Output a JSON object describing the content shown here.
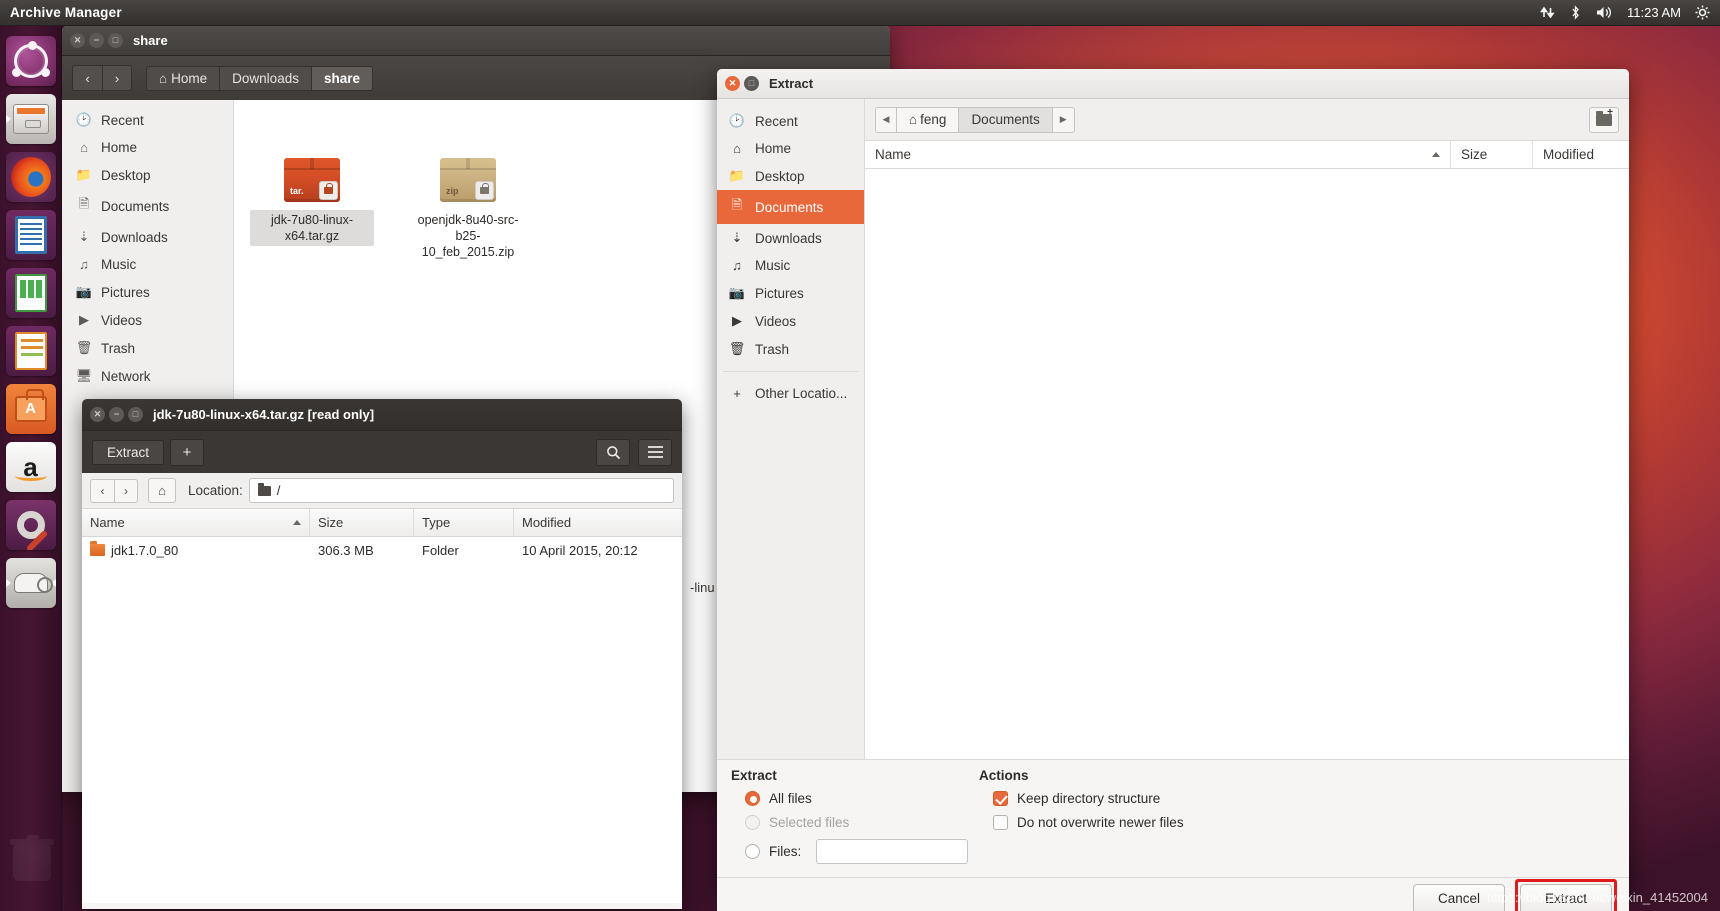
{
  "top_panel": {
    "app_title": "Archive Manager",
    "clock": "11:23 AM",
    "tray_icons": [
      "network-updown-icon",
      "bluetooth-icon",
      "volume-icon",
      "gear-icon"
    ]
  },
  "launcher": {
    "items": [
      {
        "name": "ubuntu-dash",
        "label": "Ubuntu Dash"
      },
      {
        "name": "files",
        "label": "Files"
      },
      {
        "name": "firefox",
        "label": "Firefox"
      },
      {
        "name": "libreoffice-writer",
        "label": "LibreOffice Writer"
      },
      {
        "name": "libreoffice-calc",
        "label": "LibreOffice Calc"
      },
      {
        "name": "libreoffice-impress",
        "label": "LibreOffice Impress"
      },
      {
        "name": "ubuntu-software",
        "label": "Ubuntu Software"
      },
      {
        "name": "amazon",
        "label": "Amazon"
      },
      {
        "name": "system-settings",
        "label": "System Settings"
      },
      {
        "name": "archive-manager",
        "label": "Archive Manager"
      }
    ]
  },
  "file_manager": {
    "title": "share",
    "nav": {
      "back": "‹",
      "forward": "›"
    },
    "breadcrumbs": [
      {
        "label": "Home",
        "current": false
      },
      {
        "label": "Downloads",
        "current": false
      },
      {
        "label": "share",
        "current": true
      }
    ],
    "sidebar": [
      {
        "icon": "clock-icon",
        "label": "Recent"
      },
      {
        "icon": "home-icon",
        "label": "Home"
      },
      {
        "icon": "desktop-icon",
        "label": "Desktop"
      },
      {
        "icon": "document-icon",
        "label": "Documents"
      },
      {
        "icon": "download-icon",
        "label": "Downloads"
      },
      {
        "icon": "music-icon",
        "label": "Music"
      },
      {
        "icon": "camera-icon",
        "label": "Pictures"
      },
      {
        "icon": "video-icon",
        "label": "Videos"
      },
      {
        "icon": "trash-icon",
        "label": "Trash"
      },
      {
        "icon": "network-icon",
        "label": "Network"
      }
    ],
    "files": [
      {
        "name": "jdk-7u80-linux-x64.tar.gz",
        "format": "tar.",
        "selected": true,
        "kind": "tar"
      },
      {
        "name": "openjdk-8u40-src-b25-10_feb_2015.zip",
        "format": "zip",
        "selected": false,
        "kind": "zip"
      }
    ]
  },
  "archive_manager": {
    "title": "jdk-7u80-linux-x64.tar.gz [read only]",
    "toolbar": {
      "extract": "Extract",
      "add": "+",
      "search": "search-icon",
      "menu": "hamburger-icon"
    },
    "location_label": "Location:",
    "location_value": "/",
    "columns": [
      "Name",
      "Size",
      "Type",
      "Modified"
    ],
    "rows": [
      {
        "name": "jdk1.7.0_80",
        "size": "306.3 MB",
        "type": "Folder",
        "modified": "10 April 2015, 20:12"
      }
    ]
  },
  "extract_dialog": {
    "title": "Extract",
    "places": [
      {
        "icon": "clock-icon",
        "label": "Recent",
        "selected": false
      },
      {
        "icon": "home-icon",
        "label": "Home",
        "selected": false
      },
      {
        "icon": "desktop-icon",
        "label": "Desktop",
        "selected": false
      },
      {
        "icon": "document-icon",
        "label": "Documents",
        "selected": true
      },
      {
        "icon": "download-icon",
        "label": "Downloads",
        "selected": false
      },
      {
        "icon": "music-icon",
        "label": "Music",
        "selected": false
      },
      {
        "icon": "camera-icon",
        "label": "Pictures",
        "selected": false
      },
      {
        "icon": "video-icon",
        "label": "Videos",
        "selected": false
      },
      {
        "icon": "trash-icon",
        "label": "Trash",
        "selected": false
      }
    ],
    "other_locations": "Other Locatio...",
    "path_crumbs": [
      {
        "label": "feng",
        "home": true,
        "selected": false
      },
      {
        "label": "Documents",
        "home": false,
        "selected": true
      }
    ],
    "columns": {
      "name": "Name",
      "size": "Size",
      "modified": "Modified"
    },
    "rows": [],
    "extract_group": {
      "title": "Extract",
      "all_files": {
        "label": "All files",
        "selected": true,
        "enabled": true
      },
      "selected_files": {
        "label": "Selected files",
        "selected": false,
        "enabled": false
      },
      "files": {
        "label": "Files:",
        "selected": false,
        "value": "",
        "placeholder": ""
      }
    },
    "actions_group": {
      "title": "Actions",
      "keep_directory_structure": {
        "label": "Keep directory structure",
        "checked": true
      },
      "do_not_overwrite": {
        "label": "Do not overwrite newer files",
        "checked": false
      }
    },
    "buttons": {
      "cancel": "Cancel",
      "extract": "Extract"
    },
    "highlight_color": "#e01b1b"
  },
  "watermark": "https://blog.csdn.net/weixin_41452004",
  "theme": {
    "accent": "#e8683c",
    "panel_bg": "#3c3835",
    "window_bg": "#f6f5f4",
    "desktop_purple": "#2c001e"
  }
}
